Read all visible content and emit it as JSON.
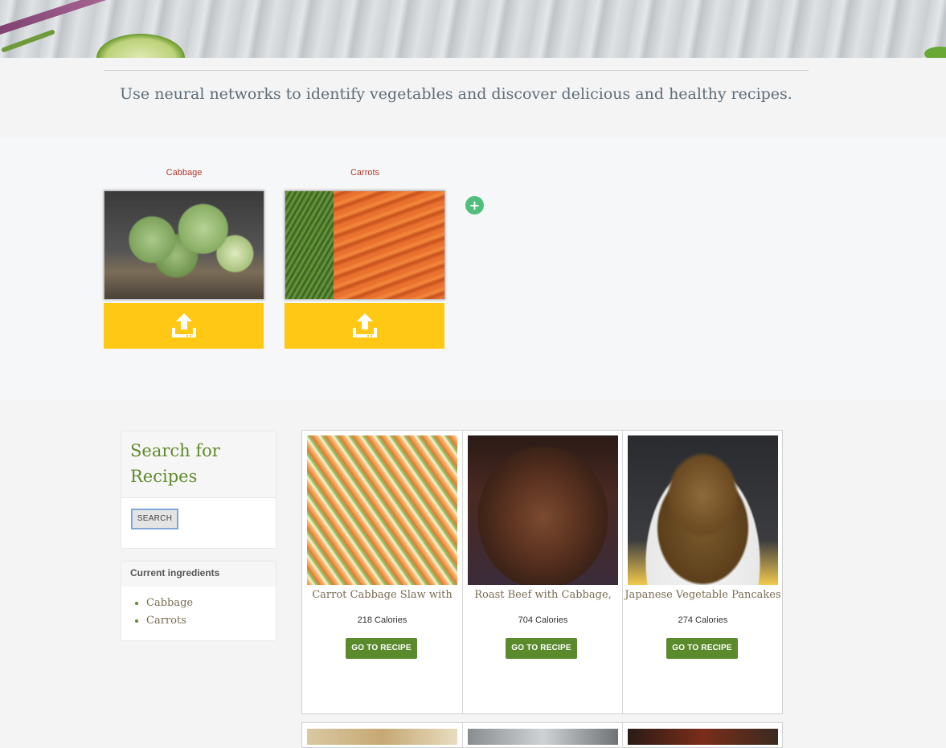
{
  "header": {
    "tagline": "Use neural networks to identify vegetables and discover delicious and healthy recipes."
  },
  "vegetables": [
    {
      "label": "Cabbage",
      "image": "cabbage-photo"
    },
    {
      "label": "Carrots",
      "image": "carrots-photo"
    }
  ],
  "upload": {
    "icon": "upload-icon",
    "add_icon": "plus-icon",
    "add_label": "+"
  },
  "search": {
    "title": "Search for Recipes",
    "button_label": "SEARCH"
  },
  "ingredients": {
    "title": "Current ingredients",
    "items": [
      "Cabbage",
      "Carrots"
    ]
  },
  "recipes": [
    {
      "title": "Carrot Cabbage Slaw with",
      "calories": "218 Calories",
      "button_label": "GO TO RECIPE"
    },
    {
      "title": "Roast Beef with Cabbage,",
      "calories": "704 Calories",
      "button_label": "GO TO RECIPE"
    },
    {
      "title": "Japanese Vegetable Pancakes",
      "calories": "274 Calories",
      "button_label": "GO TO RECIPE"
    }
  ],
  "colors": {
    "accent_green": "#5b8a2d",
    "upload_yellow": "#ffc814",
    "label_red": "#b03a2e",
    "add_green": "#4fbf7b"
  }
}
